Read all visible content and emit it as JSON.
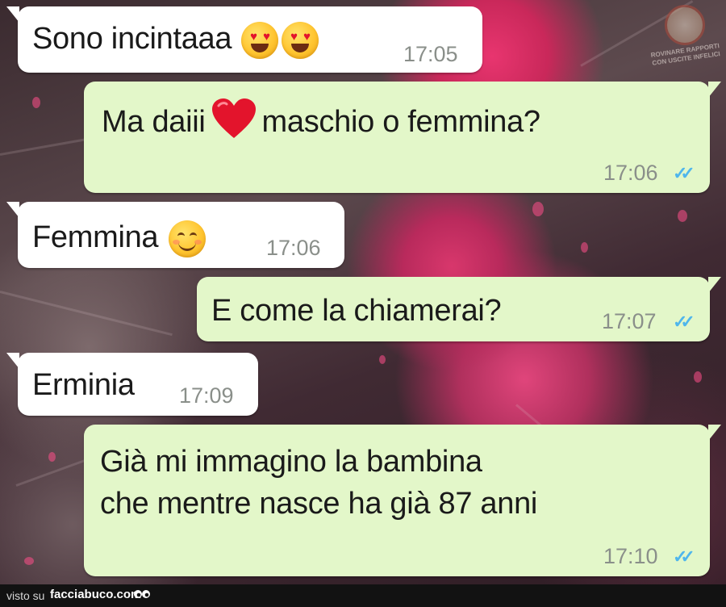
{
  "messages": [
    {
      "text": "Sono incintaaa",
      "time": "17:05",
      "direction": "incoming",
      "emoji": [
        "heart-eyes-emoji",
        "heart-eyes-emoji"
      ]
    },
    {
      "text_before": "Ma daiii",
      "text_after": "maschio o femmina?",
      "time": "17:06",
      "direction": "outgoing",
      "emoji": [
        "red-heart-emoji"
      ],
      "status": "read"
    },
    {
      "text": "Femmina",
      "time": "17:06",
      "direction": "incoming",
      "emoji": [
        "smiling-face-emoji"
      ]
    },
    {
      "text": "E come la chiamerai?",
      "time": "17:07",
      "direction": "outgoing",
      "status": "read"
    },
    {
      "text": "Erminia",
      "time": "17:09",
      "direction": "incoming"
    },
    {
      "line1": "Già mi immagino la bambina",
      "line2": "che mentre nasce ha già 87 anni",
      "time": "17:10",
      "direction": "outgoing",
      "status": "read"
    }
  ],
  "watermark": {
    "text": "ROVINARE RAPPORTI CON USCITE INFELICI",
    "icon": "badge-logo"
  },
  "footer": {
    "visto": "visto su",
    "site": "facciabuco.com",
    "icon": "eyes-icon"
  },
  "colors": {
    "incoming_bubble": "#ffffff",
    "outgoing_bubble": "#e3f7c9",
    "read_ticks": "#4fb6ec",
    "time_text": "#8a8f8a"
  }
}
